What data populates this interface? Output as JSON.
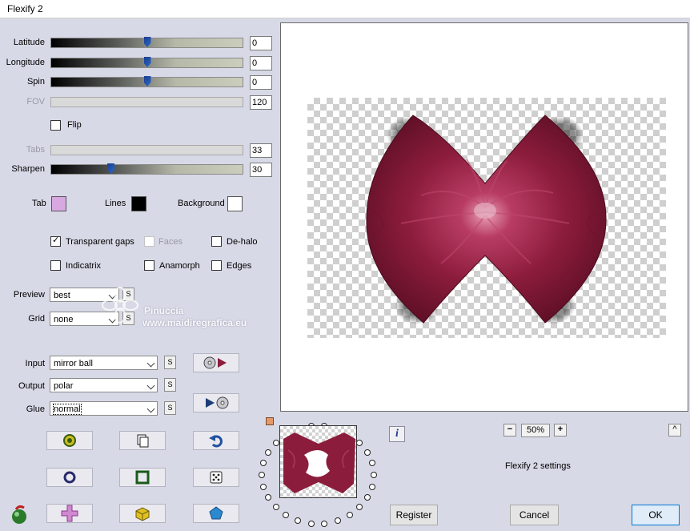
{
  "window": {
    "title": "Flexify 2"
  },
  "sliders": [
    {
      "label": "Latitude",
      "value": "0",
      "position": 0.5,
      "enabled": true
    },
    {
      "label": "Longitude",
      "value": "0",
      "position": 0.5,
      "enabled": true
    },
    {
      "label": "Spin",
      "value": "0",
      "position": 0.5,
      "enabled": true
    },
    {
      "label": "FOV",
      "value": "120",
      "position": 0.0,
      "enabled": false
    },
    {
      "label": "Tabs",
      "value": "33",
      "position": 0.0,
      "enabled": false
    },
    {
      "label": "Sharpen",
      "value": "30",
      "position": 0.31,
      "enabled": true
    }
  ],
  "flip": {
    "label": "Flip",
    "checked": false
  },
  "colors": {
    "tab": {
      "label": "Tab",
      "color": "#d8a8e0"
    },
    "lines": {
      "label": "Lines",
      "color": "#000000"
    },
    "background": {
      "label": "Background",
      "color": "#ffffff"
    }
  },
  "options": {
    "transparent_gaps": {
      "label": "Transparent gaps",
      "checked": true
    },
    "faces": {
      "label": "Faces",
      "checked": false,
      "enabled": false
    },
    "de_halo": {
      "label": "De-halo",
      "checked": false
    },
    "indicatrix": {
      "label": "Indicatrix",
      "checked": false
    },
    "anamorph": {
      "label": "Anamorph",
      "checked": false
    },
    "edges": {
      "label": "Edges",
      "checked": false
    }
  },
  "selects": {
    "preview": {
      "label": "Preview",
      "value": "best"
    },
    "grid": {
      "label": "Grid",
      "value": "none"
    },
    "input": {
      "label": "Input",
      "value": "mirror ball"
    },
    "output": {
      "label": "Output",
      "value": "polar"
    },
    "glue": {
      "label": "Glue",
      "value": "normal"
    }
  },
  "s_label": "S",
  "watermark": {
    "name": "Pinuccia",
    "site": "www.maidiregrafica.eu"
  },
  "zoom": {
    "minus": "−",
    "value": "50%",
    "plus": "+",
    "collapse": "^"
  },
  "info_label": "i",
  "settings_label": "Flexify 2 settings",
  "buttons": {
    "register": "Register",
    "cancel": "Cancel",
    "ok": "OK"
  },
  "accent_colors": {
    "crimson": "#8c1c3c",
    "preview_bg": "#ffffff",
    "panel": "#d7d9e6"
  }
}
